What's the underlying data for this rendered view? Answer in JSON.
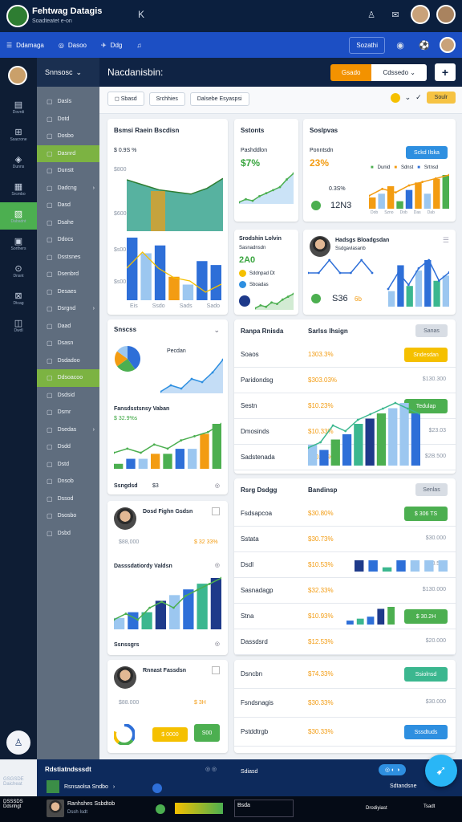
{
  "app": {
    "title": "Fehtwag Datagis",
    "subtitle": "Soadteatet e-on",
    "close": "K"
  },
  "navbar": {
    "items": [
      {
        "icon": "☰",
        "label": "Ddamaga"
      },
      {
        "icon": "◎",
        "label": "Dasoo"
      },
      {
        "icon": "✈",
        "label": "Ddg"
      },
      {
        "icon": "♫",
        "label": ""
      }
    ],
    "button": "Sozathi"
  },
  "rail": {
    "items": [
      "Dovrdi",
      "Ssacrone",
      "Dunns",
      "Srcmbo",
      "Dabadnt",
      "Sorthers",
      "Dnsnt",
      "Dtcag",
      "Dwdl"
    ],
    "foot": "GSGSDE\nDaicheat"
  },
  "side": {
    "heading": "Snnsosc",
    "items": [
      {
        "l": "Dasls",
        "a": false
      },
      {
        "l": "Dotd",
        "a": false
      },
      {
        "l": "Dosbo",
        "a": false
      },
      {
        "l": "Dasnrd",
        "a": true
      },
      {
        "l": "Dunstt",
        "a": false
      },
      {
        "l": "Dadcng",
        "a": false
      },
      {
        "l": "Dasd",
        "a": false
      },
      {
        "l": "Dsahe",
        "a": false
      },
      {
        "l": "Ddocs",
        "a": false
      },
      {
        "l": "Dsstsnes",
        "a": false
      },
      {
        "l": "Dsenbrd",
        "a": false
      },
      {
        "l": "Desaes",
        "a": false
      },
      {
        "l": "Dsrgnd",
        "a": false
      },
      {
        "l": "Daad",
        "a": false
      },
      {
        "l": "Dsasn",
        "a": false
      },
      {
        "l": "Dsdadoo",
        "a": false
      },
      {
        "l": "Ddsoacoo",
        "a": true
      },
      {
        "l": "Dsdsid",
        "a": false
      },
      {
        "l": "Dsmr",
        "a": false
      },
      {
        "l": "Dsedas",
        "a": false
      },
      {
        "l": "Dsdd",
        "a": false
      },
      {
        "l": "Dstd",
        "a": false
      },
      {
        "l": "Dnsob",
        "a": false
      },
      {
        "l": "Dssod",
        "a": false
      },
      {
        "l": "Dsosbo",
        "a": false
      },
      {
        "l": "Dsbd",
        "a": false
      }
    ]
  },
  "header": {
    "title": "Nacdanisbin:",
    "btn_orange": "Gsado",
    "btn_white": "Cdssedo",
    "plus": "+"
  },
  "toolbar": {
    "chips": [
      "Sbasd",
      "Srchhies",
      "Dalsebe Esyaspsi"
    ],
    "warn": "Soulr",
    "check": "✓",
    "chev": "⌄"
  },
  "c1": {
    "title": "Bsmsi Raein Bscdisn",
    "stat": "$ 0.9S %",
    "y1": "$800",
    "y2": "$600",
    "y3": "$s00",
    "y4": "$s00",
    "xl": [
      "Eis",
      "Ssdo",
      "Sads",
      "Sado"
    ],
    "series": [
      {
        "name": "Dovrsd Hecan",
        "values": [
          72,
          65,
          58,
          55,
          52,
          60,
          74
        ]
      },
      {
        "name": "Dansde",
        "values": [
          70,
          80,
          70,
          64,
          62,
          55,
          60
        ]
      }
    ]
  },
  "c2": {
    "title": "Sstonts",
    "sub": "Pashddlon",
    "val": "$7%",
    "spark": [
      10,
      14,
      12,
      18,
      22,
      26,
      30,
      40,
      48
    ]
  },
  "c3": {
    "title": "Soslpvas",
    "sub": "Ponntsdn",
    "val": "23%",
    "btn": "Sckd Ilska",
    "pct": "0.3S%",
    "val2": "12N3",
    "legend": [
      "Dunid",
      "Sdnst",
      "Srtnsd"
    ],
    "bars": [
      3,
      4,
      6,
      2,
      5,
      7,
      4,
      8,
      9
    ],
    "xl": [
      "Dob",
      "Szno",
      "Dob",
      "Das",
      "Dab"
    ]
  },
  "c4": {
    "title": "Srodshin Lolvin",
    "sub": "Sasnadnsdn",
    "val": "2A0",
    "rows": [
      "Sddnpad Dt",
      "Sboadas"
    ],
    "spark": [
      4,
      6,
      5,
      8,
      7,
      10,
      12,
      14
    ]
  },
  "c5": {
    "title": "Hadsgs Bloadgsdan",
    "sub": "Ssdgavlasanb",
    "val": "S36",
    "pct": "6b",
    "bars": [
      3,
      8,
      4,
      7,
      9,
      5,
      6
    ]
  },
  "c6": {
    "title": "Snscss",
    "pie": [
      40,
      25,
      20,
      15
    ],
    "label": "Pecdan",
    "trend": [
      2,
      4,
      3,
      6,
      5,
      8,
      12
    ]
  },
  "c7": {
    "title": "Fansdsstsnsy Vaban",
    "sub": "$ 32.9%s",
    "bars": [
      1,
      2,
      2,
      3,
      3,
      4,
      4,
      7,
      9
    ]
  },
  "c8": {
    "title": "Ssngdsd",
    "val": "$3"
  },
  "table1": {
    "head": [
      "Ranpa Rnisda",
      "Sarlss Ihsign"
    ],
    "btn": "Sanas",
    "rows": [
      {
        "n": "Soaos",
        "v": "1303.3%",
        "btn": "Sndesdan",
        "btnc": "y",
        "r": ""
      },
      {
        "n": "Paridondsg",
        "v": "$303.03%",
        "btn": "",
        "btnc": "",
        "r": "$130.300"
      },
      {
        "n": "Sestn",
        "v": "$10.23%",
        "btn": "Tedulap",
        "btnc": "g",
        "r": ""
      },
      {
        "n": "Dmosinds",
        "v": "$10.33%",
        "btn": "",
        "btnc": "",
        "r": "$23.03"
      },
      {
        "n": "Sadstenada",
        "v": "$30.83%",
        "btn": "",
        "btnc": "",
        "r": "$2B.500"
      }
    ],
    "bars": [
      4,
      3,
      5,
      6,
      8,
      9,
      10,
      11,
      12,
      10
    ]
  },
  "p1": {
    "name": "Dosd Fighn Gsdsn",
    "val": "$ 32 33%",
    "stat": "$88,000"
  },
  "p2": {
    "title": "Dasssdatiordy Valdsn",
    "line": [
      2,
      3,
      2,
      4,
      5,
      4,
      6,
      7,
      8,
      9
    ],
    "bars": [
      3,
      4,
      5,
      6,
      7,
      8
    ]
  },
  "p3": {
    "title": "Ssnssgrs",
    "val": ""
  },
  "p4": {
    "name": "Rnnast Fassdsn",
    "stat": "$88.000",
    "btn1": "$ 0000",
    "btn2": "S00"
  },
  "table2": {
    "head": [
      "Rsrg Dsdgg",
      "Bandinsp"
    ],
    "btn": "Senlas",
    "rows": [
      {
        "n": "Fsdsapcoa",
        "v": "$30.80%",
        "btn": "$ 306 TS",
        "btnc": "g",
        "r": ""
      },
      {
        "n": "Sstata",
        "v": "$30.73%",
        "btn": "",
        "btnc": "",
        "r": "$30.000"
      },
      {
        "n": "Dsdl",
        "v": "$10.53%",
        "btn": "",
        "btnc": "",
        "r": "$80.500"
      },
      {
        "n": "Sasnadagp",
        "v": "$32.33%",
        "btn": "",
        "btnc": "",
        "r": "$130.000"
      },
      {
        "n": "Stna",
        "v": "$10.93%",
        "btn": "$ 30.2H",
        "btnc": "g",
        "r": ""
      },
      {
        "n": "Dassdsrd",
        "v": "$12.53%",
        "btn": "",
        "btnc": "",
        "r": "$20.000"
      }
    ]
  },
  "table3": {
    "rows": [
      {
        "n": "Dsncbn",
        "v": "$74.33%",
        "btn": "Ssiolnsd",
        "btnc": "t",
        "r": ""
      },
      {
        "n": "Fsndsnagis",
        "v": "$30.33%",
        "btn": "",
        "btnc": "",
        "r": "$30.000"
      },
      {
        "n": "Pstddtrgb",
        "v": "$30.33%",
        "btn": "Sssdtuds",
        "btnc": "b",
        "r": ""
      }
    ]
  },
  "bottom": {
    "title": "Rdstiatndsssdt",
    "item": "Rsnsaolsa Sndbo",
    "sub": "Bddtt Tranda",
    "mid": "Sdiasd",
    "right": "Sdtandsne",
    "gd": "Gusd"
  },
  "status": {
    "left": "DSSSDS\nDdsnhgt",
    "name": "Ranhshes Ssbdtob",
    "sub": "Dssh Isdt",
    "midval": "Bsda",
    "r1": "Drodiyiast",
    "r2": "Tsadt"
  }
}
